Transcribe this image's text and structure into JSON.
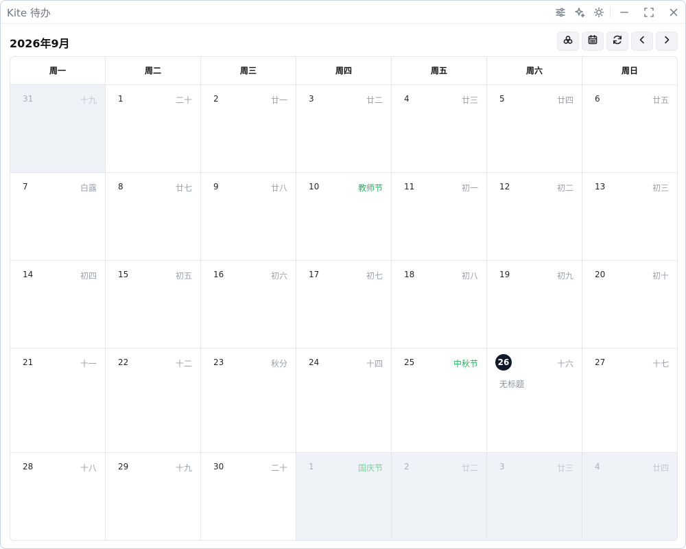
{
  "app": {
    "title": "Kite 待办"
  },
  "header": {
    "month_title": "2026年9月"
  },
  "weekdays": [
    "周一",
    "周二",
    "周三",
    "周四",
    "周五",
    "周六",
    "周日"
  ],
  "weeks": [
    [
      {
        "day": "31",
        "lunar": "十九",
        "other": true
      },
      {
        "day": "1",
        "lunar": "二十"
      },
      {
        "day": "2",
        "lunar": "廿一"
      },
      {
        "day": "3",
        "lunar": "廿二"
      },
      {
        "day": "4",
        "lunar": "廿三"
      },
      {
        "day": "5",
        "lunar": "廿四"
      },
      {
        "day": "6",
        "lunar": "廿五"
      }
    ],
    [
      {
        "day": "7",
        "lunar": "白露"
      },
      {
        "day": "8",
        "lunar": "廿七"
      },
      {
        "day": "9",
        "lunar": "廿八"
      },
      {
        "day": "10",
        "lunar": "教师节",
        "festival": true
      },
      {
        "day": "11",
        "lunar": "初一"
      },
      {
        "day": "12",
        "lunar": "初二"
      },
      {
        "day": "13",
        "lunar": "初三"
      }
    ],
    [
      {
        "day": "14",
        "lunar": "初四"
      },
      {
        "day": "15",
        "lunar": "初五"
      },
      {
        "day": "16",
        "lunar": "初六"
      },
      {
        "day": "17",
        "lunar": "初七"
      },
      {
        "day": "18",
        "lunar": "初八"
      },
      {
        "day": "19",
        "lunar": "初九"
      },
      {
        "day": "20",
        "lunar": "初十"
      }
    ],
    [
      {
        "day": "21",
        "lunar": "十一"
      },
      {
        "day": "22",
        "lunar": "十二"
      },
      {
        "day": "23",
        "lunar": "秋分"
      },
      {
        "day": "24",
        "lunar": "十四"
      },
      {
        "day": "25",
        "lunar": "中秋节",
        "festival": true
      },
      {
        "day": "26",
        "lunar": "十六",
        "today": true,
        "event": "无标题"
      },
      {
        "day": "27",
        "lunar": "十七"
      }
    ],
    [
      {
        "day": "28",
        "lunar": "十八"
      },
      {
        "day": "29",
        "lunar": "十九"
      },
      {
        "day": "30",
        "lunar": "二十"
      },
      {
        "day": "1",
        "lunar": "国庆节",
        "other": true,
        "festival": true
      },
      {
        "day": "2",
        "lunar": "廿二",
        "other": true
      },
      {
        "day": "3",
        "lunar": "廿三",
        "other": true
      },
      {
        "day": "4",
        "lunar": "廿四",
        "other": true
      }
    ]
  ],
  "colors": {
    "festival": "#27ae60",
    "today_badge": "#111827",
    "other_month_bg": "#eff2f7"
  },
  "icons": {
    "titlebar": [
      "sliders-icon",
      "sparkles-icon",
      "sun-icon",
      "minimize-icon",
      "maximize-icon",
      "close-icon"
    ],
    "toolbar": [
      "layers-icon",
      "calendar-icon",
      "refresh-icon",
      "chevron-left-icon",
      "chevron-right-icon"
    ]
  }
}
